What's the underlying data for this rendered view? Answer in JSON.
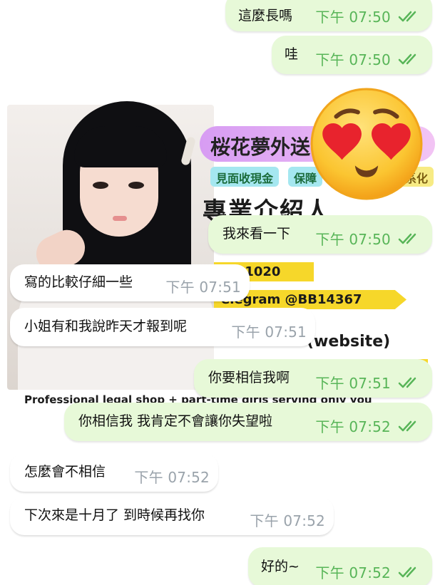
{
  "sticker": {
    "banner_title": "桜花夢外送",
    "pills": [
      "見面收現金",
      "保障",
      "系化"
    ],
    "heading": "專業介紹人",
    "tag_line_id": ": JP1020",
    "tag_telegram": "elegram @BB14367",
    "tag_website": "(website)",
    "footer": "Professional legal shop + part-time girls serving only you"
  },
  "messages": [
    {
      "dir": "out",
      "text": "這麼長嗎",
      "time": "下午 07:50",
      "read": true
    },
    {
      "dir": "out",
      "text": "哇",
      "time": "下午 07:50",
      "read": true
    },
    {
      "dir": "out",
      "text": "我來看一下",
      "time": "下午 07:50",
      "read": true
    },
    {
      "dir": "in",
      "text": "寫的比較仔細一些",
      "time": "下午 07:51"
    },
    {
      "dir": "in",
      "text": "小姐有和我說昨天才報到呢",
      "time": "下午 07:51"
    },
    {
      "dir": "out",
      "text": "你要相信我啊",
      "time": "下午 07:51",
      "read": true
    },
    {
      "dir": "out",
      "text": "你相信我 我肯定不會讓你失望啦",
      "time": "下午 07:52",
      "read": true
    },
    {
      "dir": "in",
      "text": "怎麼會不相信",
      "time": "下午 07:52"
    },
    {
      "dir": "in",
      "text": "下次來是十月了 到時候再找你",
      "time": "下午 07:52"
    },
    {
      "dir": "out",
      "text": "好的~",
      "time": "下午 07:52",
      "read": true
    }
  ],
  "colors": {
    "outgoing_bubble": "#e7f9d8",
    "incoming_bubble": "#ffffff",
    "outgoing_meta": "#58b558",
    "incoming_meta": "#9aa3ab"
  },
  "icons": {
    "read_receipt": "double-check-icon",
    "emoji": "heart-eyes-emoji"
  }
}
